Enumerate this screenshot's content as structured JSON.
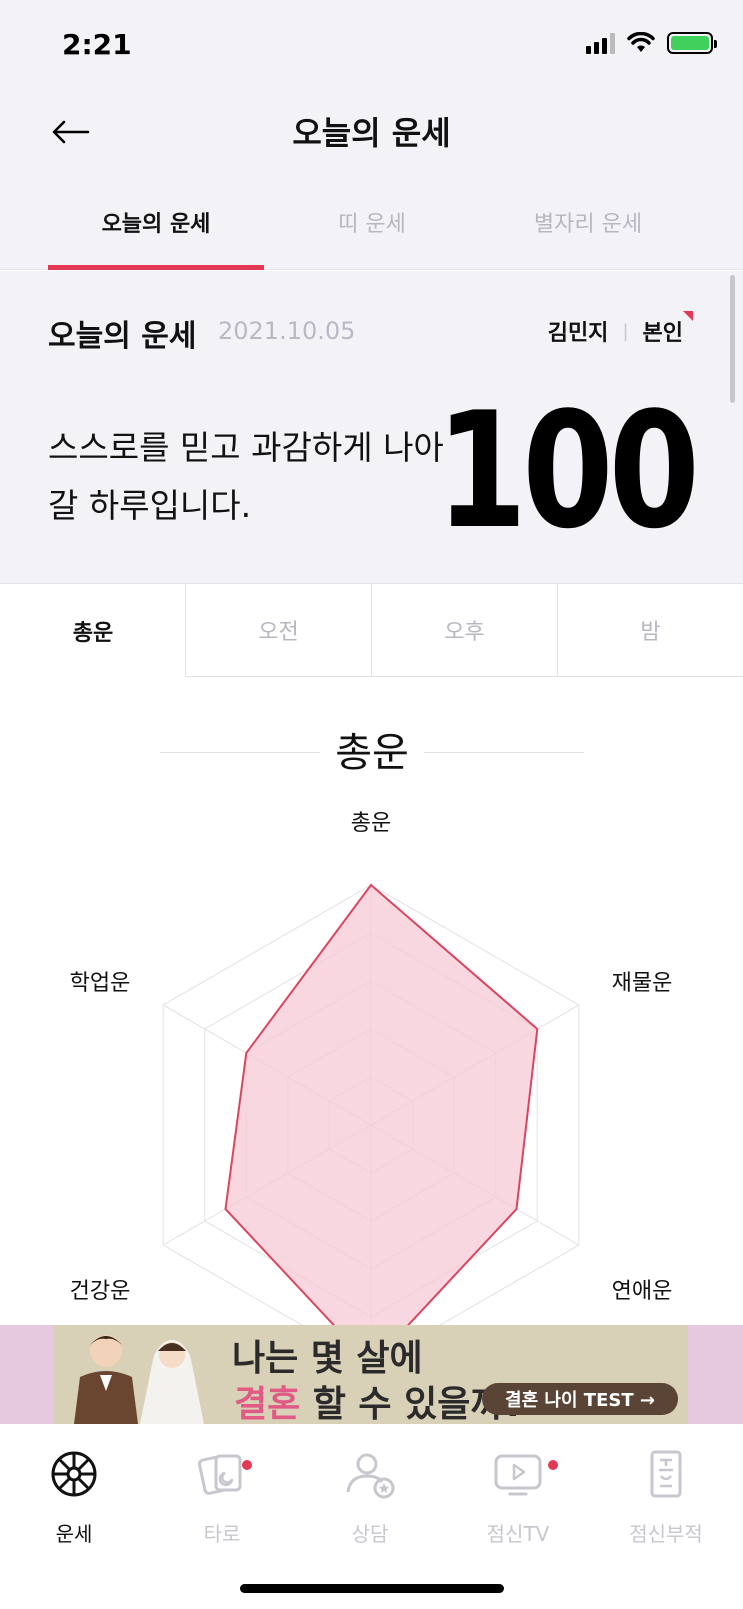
{
  "status_bar": {
    "time": "2:21"
  },
  "header": {
    "title": "오늘의 운세"
  },
  "tabs": [
    {
      "label": "오늘의 운세",
      "active": true
    },
    {
      "label": "띠 운세",
      "active": false
    },
    {
      "label": "별자리 운세",
      "active": false
    }
  ],
  "summary": {
    "title": "오늘의 운세",
    "date": "2021.10.05",
    "user_name": "김민지",
    "relation": "본인",
    "message": "스스로를 믿고 과감하게 나아갈 하루입니다.",
    "score": "100"
  },
  "time_tabs": [
    {
      "label": "총운",
      "active": true
    },
    {
      "label": "오전",
      "active": false
    },
    {
      "label": "오후",
      "active": false
    },
    {
      "label": "밤",
      "active": false
    }
  ],
  "radar": {
    "title": "총운",
    "axes": [
      "총운",
      "재물운",
      "연애운",
      "건강운",
      "학업운"
    ],
    "values": [
      100,
      80,
      70,
      100,
      70,
      60
    ],
    "colors": {
      "fill": "#f5c9d5",
      "stroke": "#d9465e"
    }
  },
  "banner": {
    "line1": "나는 몇 살에",
    "line2_highlight": "결혼",
    "line2_rest": " 할 수 있을까?",
    "button": "결혼 나이 TEST →"
  },
  "bottom_nav": [
    {
      "label": "운세",
      "icon": "fortune-wheel-icon",
      "active": true,
      "badge": false
    },
    {
      "label": "타로",
      "icon": "tarot-cards-icon",
      "active": false,
      "badge": true
    },
    {
      "label": "상담",
      "icon": "consult-person-icon",
      "active": false,
      "badge": false
    },
    {
      "label": "점신TV",
      "icon": "tv-play-icon",
      "active": false,
      "badge": true
    },
    {
      "label": "점신부적",
      "icon": "talisman-icon",
      "active": false,
      "badge": false
    }
  ]
}
